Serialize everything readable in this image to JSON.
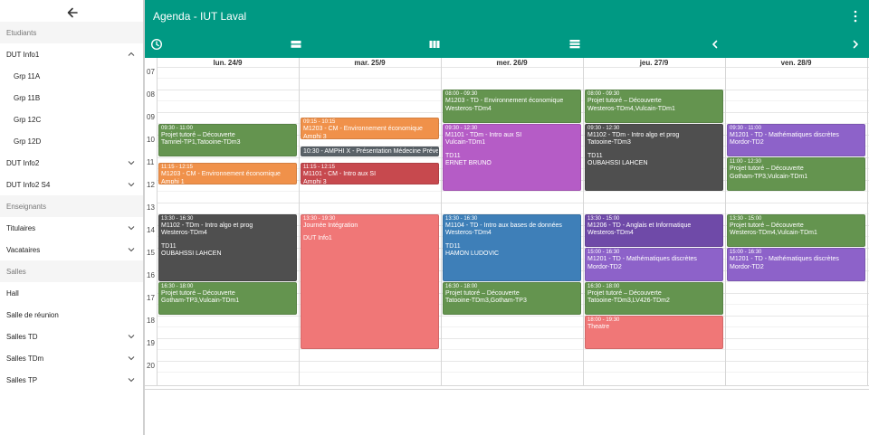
{
  "header": {
    "title": "Agenda - IUT Laval"
  },
  "sidebar": {
    "rows": [
      {
        "type": "header",
        "label": "Etudiants",
        "chevron": ""
      },
      {
        "type": "item",
        "label": "DUT Info1",
        "chevron": "up"
      },
      {
        "type": "sub",
        "label": "Grp 11A",
        "chevron": ""
      },
      {
        "type": "sub",
        "label": "Grp 11B",
        "chevron": ""
      },
      {
        "type": "sub",
        "label": "Grp 12C",
        "chevron": ""
      },
      {
        "type": "sub",
        "label": "Grp 12D",
        "chevron": ""
      },
      {
        "type": "item",
        "label": "DUT Info2",
        "chevron": "down"
      },
      {
        "type": "item",
        "label": "DUT Info2 S4",
        "chevron": "down"
      },
      {
        "type": "header",
        "label": "Enseignants",
        "chevron": ""
      },
      {
        "type": "item",
        "label": "Titulaires",
        "chevron": "down"
      },
      {
        "type": "item",
        "label": "Vacataires",
        "chevron": "down"
      },
      {
        "type": "header",
        "label": "Salles",
        "chevron": ""
      },
      {
        "type": "item",
        "label": "Hall",
        "chevron": ""
      },
      {
        "type": "item",
        "label": "Salle de réunion",
        "chevron": ""
      },
      {
        "type": "item",
        "label": "Salles TD",
        "chevron": "down"
      },
      {
        "type": "item",
        "label": "Salles TDm",
        "chevron": "down"
      },
      {
        "type": "item",
        "label": "Salles TP",
        "chevron": "down"
      }
    ]
  },
  "toolbar": {
    "buttons": [
      "clock-icon",
      "view-day-icon",
      "view-week-icon",
      "view-agenda-icon",
      "chevron-left-icon",
      "chevron-right-icon"
    ]
  },
  "calendar": {
    "days": [
      "lun. 24/9",
      "mar. 25/9",
      "mer. 26/9",
      "jeu. 27/9",
      "ven. 28/9"
    ],
    "hours": [
      "07",
      "08",
      "09",
      "10",
      "11",
      "12",
      "13",
      "14",
      "15",
      "16",
      "17",
      "18",
      "19",
      "20"
    ],
    "events": [
      {
        "day": 0,
        "start": 9.5,
        "end": 11.0,
        "color": "#64944f",
        "time": "09:30 - 11:00",
        "lines": [
          "Projet tutoré – Découverte",
          "Tamriel-TP1,Tatooine-TDm3"
        ]
      },
      {
        "day": 0,
        "start": 11.25,
        "end": 12.25,
        "color": "#f0914a",
        "time": "11:15 - 12:15",
        "lines": [
          "M1203 - CM - Environnement économique",
          "Amphi 1"
        ]
      },
      {
        "day": 0,
        "start": 13.5,
        "end": 16.5,
        "color": "#4f4f4f",
        "time": "13:30 - 16:30",
        "lines": [
          "M1102 - TDm - Intro algo et prog",
          "Westeros-TDm4",
          "",
          "TD11",
          "OUBAHSSI LAHCEN"
        ]
      },
      {
        "day": 0,
        "start": 16.5,
        "end": 18.0,
        "color": "#64944f",
        "time": "16:30 - 18:00",
        "lines": [
          "Projet tutoré – Découverte",
          "Gotham-TP3,Vulcain-TDm1"
        ]
      },
      {
        "day": 1,
        "start": 9.25,
        "end": 10.25,
        "color": "#f0914a",
        "time": "09:15 - 10:15",
        "lines": [
          "M1203 - CM - Environnement économique",
          "Amphi 3"
        ]
      },
      {
        "day": 1,
        "start": 10.5,
        "end": 11.0,
        "color": "#5a6268",
        "time": "",
        "lines": [
          "10:30 - AMPHI X - Présentation Médecine Préventive et Aide"
        ]
      },
      {
        "day": 1,
        "start": 11.25,
        "end": 12.25,
        "color": "#c7494e",
        "time": "11:15 - 12:15",
        "lines": [
          "M1101 - CM - Intro aux SI",
          "Amphi 3"
        ]
      },
      {
        "day": 1,
        "start": 13.5,
        "end": 19.5,
        "color": "#f07777",
        "time": "13:30 - 19:30",
        "lines": [
          "Journée Intégration",
          "",
          "DUT Info1"
        ]
      },
      {
        "day": 2,
        "start": 8.0,
        "end": 9.5,
        "color": "#64944f",
        "time": "08:00 - 09:30",
        "lines": [
          "M1203 - TD - Environnement économique",
          "Westeros-TDm4"
        ]
      },
      {
        "day": 2,
        "start": 9.5,
        "end": 12.5,
        "color": "#b55cc6",
        "time": "09:30 - 12:30",
        "lines": [
          "M1101 - TDm - Intro aux SI",
          "Vulcain-TDm1",
          "",
          "TD11",
          "ERNET BRUNO"
        ]
      },
      {
        "day": 2,
        "start": 13.5,
        "end": 16.5,
        "color": "#3e7fb8",
        "time": "13:30 - 16:30",
        "lines": [
          "M1104 - TD - Intro aux bases de données",
          "Westeros-TDm4",
          "",
          "TD11",
          "HAMON LUDOVIC"
        ]
      },
      {
        "day": 2,
        "start": 16.5,
        "end": 18.0,
        "color": "#64944f",
        "time": "16:30 - 18:00",
        "lines": [
          "Projet tutoré – Découverte",
          "Tatooine-TDm3,Gotham-TP3"
        ]
      },
      {
        "day": 3,
        "start": 8.0,
        "end": 9.5,
        "color": "#64944f",
        "time": "08:00 - 09:30",
        "lines": [
          "Projet tutoré – Découverte",
          "Westeros-TDm4,Vulcain-TDm1"
        ]
      },
      {
        "day": 3,
        "start": 9.5,
        "end": 12.5,
        "color": "#4f4f4f",
        "time": "09:30 - 12:30",
        "lines": [
          "M1102 - TDm - Intro algo et prog",
          "Tatooine-TDm3",
          "",
          "TD11",
          "OUBAHSSI LAHCEN"
        ]
      },
      {
        "day": 3,
        "start": 13.5,
        "end": 15.0,
        "color": "#6f4aa8",
        "time": "13:30 - 15:00",
        "lines": [
          "M1206 - TD - Anglais et Informatique",
          "Westeros-TDm4"
        ]
      },
      {
        "day": 3,
        "start": 15.0,
        "end": 16.5,
        "color": "#8d62c9",
        "time": "15:00 - 16:30",
        "lines": [
          "M1201 - TD - Mathématiques discrètes",
          "Mordor-TD2"
        ]
      },
      {
        "day": 3,
        "start": 16.5,
        "end": 18.0,
        "color": "#64944f",
        "time": "16:30 - 18:00",
        "lines": [
          "Projet tutoré – Découverte",
          "Tatooine-TDm3,LV426-TDm2"
        ]
      },
      {
        "day": 3,
        "start": 18.0,
        "end": 19.5,
        "color": "#f07777",
        "time": "18:00 - 19:30",
        "lines": [
          "Theatre"
        ]
      },
      {
        "day": 4,
        "start": 9.5,
        "end": 11.0,
        "color": "#8d62c9",
        "time": "09:30 - 11:00",
        "lines": [
          "M1201 - TD - Mathématiques discrètes",
          "Mordor-TD2"
        ]
      },
      {
        "day": 4,
        "start": 11.0,
        "end": 12.5,
        "color": "#64944f",
        "time": "11:00 - 12:30",
        "lines": [
          "Projet tutoré – Découverte",
          "Gotham-TP3,Vulcain-TDm1"
        ]
      },
      {
        "day": 4,
        "start": 13.5,
        "end": 15.0,
        "color": "#64944f",
        "time": "13:30 - 15:00",
        "lines": [
          "Projet tutoré – Découverte",
          "Westeros-TDm4,Vulcain-TDm1"
        ]
      },
      {
        "day": 4,
        "start": 15.0,
        "end": 16.5,
        "color": "#8d62c9",
        "time": "15:00 - 16:30",
        "lines": [
          "M1201 - TD - Mathématiques discrètes",
          "Mordor-TD2"
        ]
      }
    ]
  }
}
